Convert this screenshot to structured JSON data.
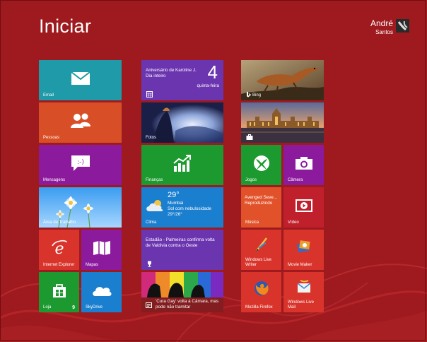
{
  "screen": {
    "title": "Iniciar"
  },
  "user": {
    "first_name": "André",
    "last_name": "Santos"
  },
  "col1": {
    "email": "Email",
    "pessoas": "Pessoas",
    "mensagens": "Mensagens",
    "area_trabalho": "Área de Trabalho",
    "ie": "Internet Explorer",
    "mapas": "Mapas",
    "loja": "Loja",
    "loja_badge": "9",
    "skydrive": "SkyDrive"
  },
  "col2": {
    "calendar_event": "Aniversário de Karoline J.",
    "calendar_when": "Dia inteiro",
    "calendar_day": "4",
    "calendar_weekday": "quinta-feira",
    "fotos": "Fotos",
    "financas": "Finanças",
    "weather_temp": "29°",
    "weather_city": "Mumbai",
    "weather_desc": "Sol com nebulosidade",
    "weather_range": "29°/26°",
    "clima": "Clima",
    "news_headline": "Estadão - Palmeiras confirma volta de Valdivia contra o Oeste",
    "news2_headline": "'Cura Gay' volta à Câmara, mas pode não tramitar"
  },
  "col3": {
    "bing": "Bing",
    "jogos": "Jogos",
    "camera": "Câmera",
    "music_artist": "Avenged Seve...",
    "music_status": "Reproduzindo",
    "musica": "Música",
    "video": "Vídeo",
    "wlw": "Windows Live Writer",
    "moviemaker": "Movie Maker",
    "firefox": "Mozilla Firefox",
    "wlmail": "Windows Live Mail"
  },
  "colors": {
    "background": "#9e1a1e",
    "email": "#1e9aa8",
    "pessoas": "#d84f27",
    "purple": "#8c1a9c",
    "blue": "#1b7fd0",
    "calendar": "#6b35b0",
    "green": "#1d9a2f",
    "red_tile": "#d9342c",
    "orange": "#e2522a"
  },
  "icons": [
    "mail-icon",
    "people-icon",
    "message-icon",
    "ie-icon",
    "maps-icon",
    "store-icon",
    "skydrive-icon",
    "calendar-icon",
    "finance-icon",
    "weather-icon",
    "trophy-icon",
    "news-icon",
    "bing-icon",
    "games-icon",
    "camera-icon",
    "video-icon",
    "wlw-icon",
    "moviemaker-icon",
    "firefox-icon",
    "wlmail-icon"
  ]
}
